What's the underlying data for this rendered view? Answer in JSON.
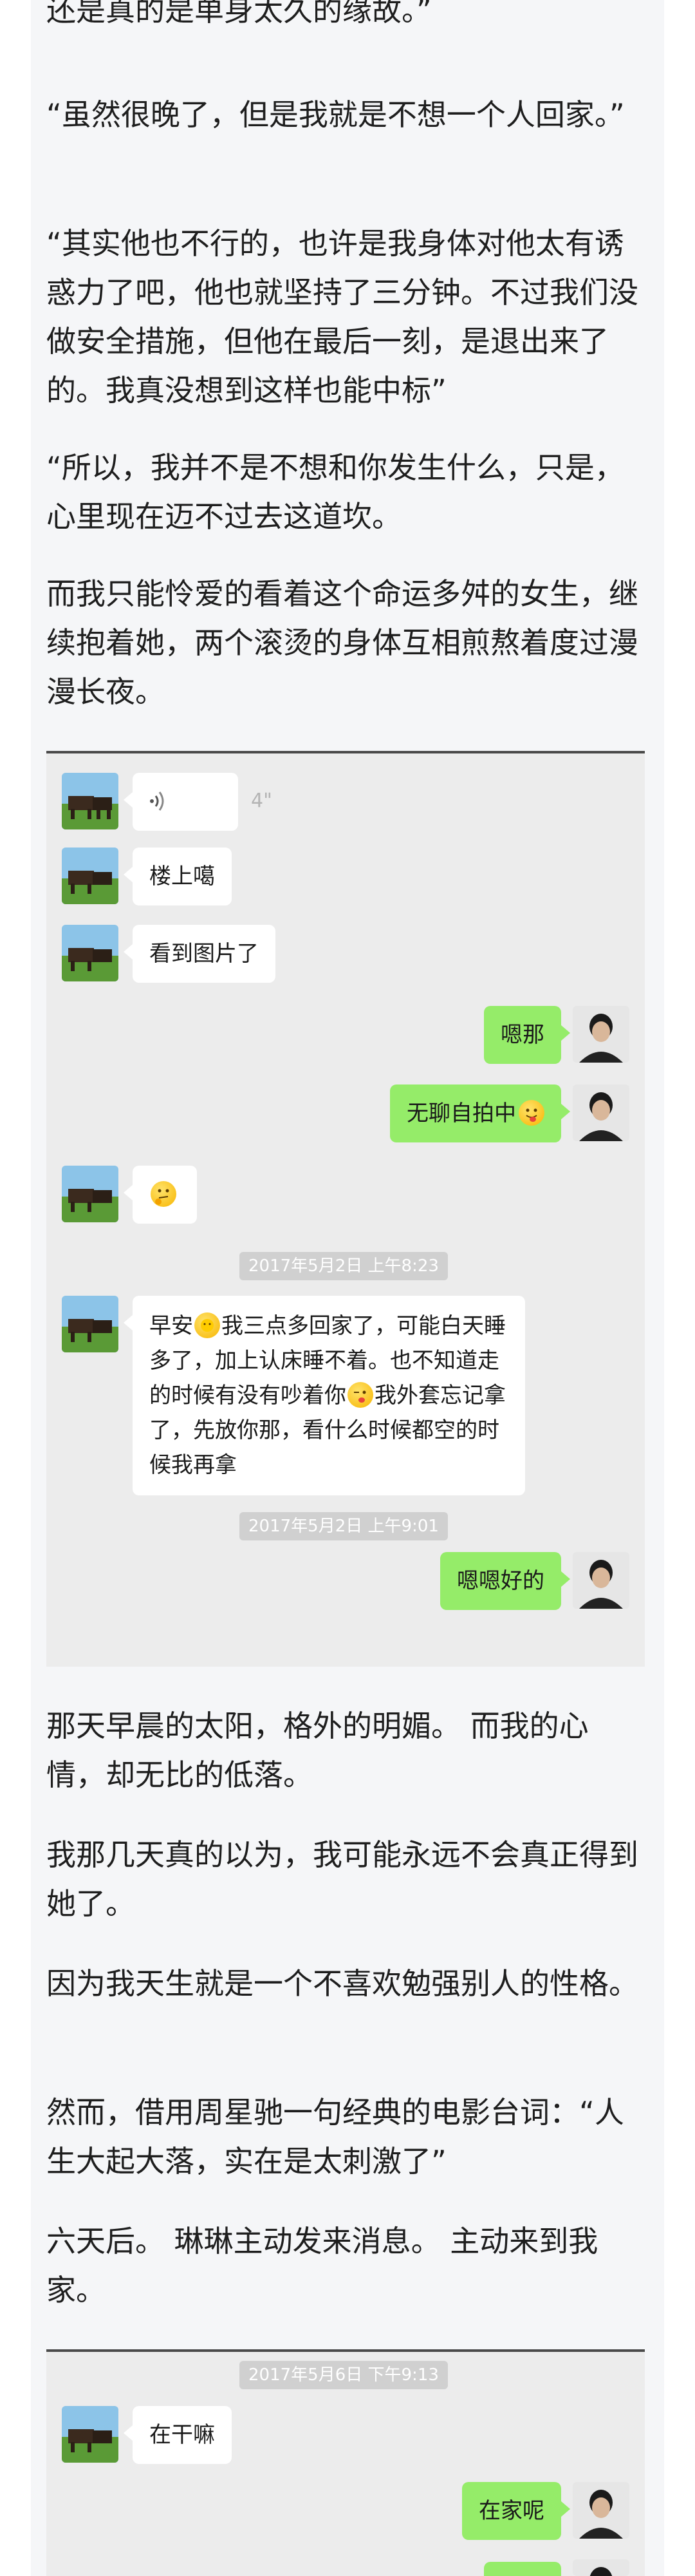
{
  "article": {
    "p1": "还是真的是单身太久的缘故。”",
    "p2": "“虽然很晚了，但是我就是不想一个人回家。”",
    "p3": " “其实他也不行的，也许是我身体对他太有诱惑力了吧，他也就坚持了三分钟。不过我们没做安全措施，但他在最后一刻，是退出来了的。我真没想到这样也能中标”",
    "p4": "“所以，我并不是不想和你发生什么，只是，心里现在迈不过去这道坎。",
    "p5": "而我只能怜爱的看着这个命运多舛的女生，继续抱着她，两个滚烫的身体互相煎熬着度过漫漫长夜。",
    "p6": "那天早晨的太阳，格外的明媚。 而我的心情，却无比的低落。",
    "p7": "我那几天真的以为，我可能永远不会真正得到她了。",
    "p8": "因为我天生就是一个不喜欢勉强别人的性格。",
    "p9": "然而，借用周星驰一句经典的电影台词：“人生大起大落，实在是太刺激了”",
    "p10": "六天后。 琳琳主动发来消息。 主动来到我家。"
  },
  "chat1": {
    "voice_icon": "voice-wave-icon",
    "voice_duration": "4\"",
    "msg_lou": "楼上噶",
    "msg_kan": "看到图片了",
    "msg_en": "嗯那",
    "msg_wuliao": "无聊自拍中",
    "msg_wuliao_emoji": "tongue-face-emoji",
    "msg_emoji_only": "thinking-face-emoji",
    "ts1": "2017年5月2日 上午8:23",
    "msg_zaoan_prefix": "早安",
    "msg_zaoan_sun": "sun-emoji",
    "msg_zaoan_text1": "我三点多回家了，可能白天睡多了，加上认床睡不着。也不知道走的时候有没有吵着你",
    "msg_zaoan_wink": "wink-emoji",
    "msg_zaoan_text2": "我外套忘记拿了，先放你那，看什么时候都空的时候我再拿",
    "ts2": "2017年5月2日 上午9:01",
    "msg_enen": "嗯嗯好的"
  },
  "chat2": {
    "ts": "2017年5月6日 下午9:13",
    "msg_zaiganma": "在干嘛",
    "msg_zaijia": "在家呢"
  },
  "colors": {
    "chat_bg": "#ececec",
    "bubble_in": "#ffffff",
    "bubble_out": "#95ec69",
    "page_column": "#f5f6f8"
  }
}
